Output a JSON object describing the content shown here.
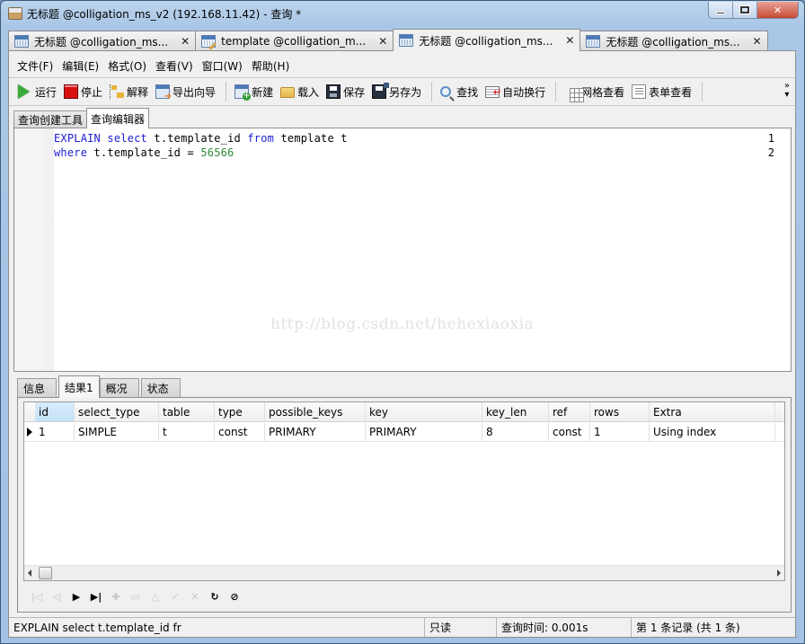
{
  "window": {
    "title": "无标题 @colligation_ms_v2 (192.168.11.42) - 查询 *",
    "controls": {
      "minimize": "minimize",
      "maximize": "maximize",
      "close": "close"
    }
  },
  "doc_tabs": [
    {
      "label": "无标题 @colligation_ms...",
      "icon": "query-grid-icon",
      "active": false
    },
    {
      "label": "template @colligation_m...",
      "icon": "table-edit-icon",
      "active": false
    },
    {
      "label": "无标题 @colligation_ms...",
      "icon": "query-grid-icon",
      "active": true
    },
    {
      "label": "无标题 @colligation_ms...",
      "icon": "query-grid-icon",
      "active": false
    }
  ],
  "doc_tab_close": "✕",
  "menu": [
    "文件(F)",
    "编辑(E)",
    "格式(O)",
    "查看(V)",
    "窗口(W)",
    "帮助(H)"
  ],
  "toolbar": {
    "run": "运行",
    "stop": "停止",
    "explain": "解释",
    "export_wizard": "导出向导",
    "new": "新建",
    "load": "载入",
    "save": "保存",
    "save_as": "另存为",
    "find": "查找",
    "word_wrap": "自动换行",
    "grid_view": "网格查看",
    "form_view": "表单查看",
    "overflow": "»"
  },
  "editor_tabs": [
    {
      "label": "查询创建工具",
      "active": false
    },
    {
      "label": "查询编辑器",
      "active": true
    }
  ],
  "editor": {
    "lines": [
      {
        "no": "1",
        "tokens": [
          {
            "t": "EXPLAIN",
            "k": "kw"
          },
          {
            "t": " "
          },
          {
            "t": "select",
            "k": "kw"
          },
          {
            "t": " t.template_id "
          },
          {
            "t": "from",
            "k": "kw"
          },
          {
            "t": " template t"
          }
        ]
      },
      {
        "no": "2",
        "tokens": [
          {
            "t": "where",
            "k": "kw"
          },
          {
            "t": " t.template_id = "
          },
          {
            "t": "56566",
            "k": "num"
          }
        ]
      }
    ],
    "watermark": "http://blog.csdn.net/hehexiaoxia"
  },
  "result_tabs": [
    {
      "label": "信息",
      "active": false
    },
    {
      "label": "结果1",
      "active": true
    },
    {
      "label": "概况",
      "active": false
    },
    {
      "label": "状态",
      "active": false
    }
  ],
  "result_grid": {
    "columns": [
      "id",
      "select_type",
      "table",
      "type",
      "possible_keys",
      "key",
      "key_len",
      "ref",
      "rows",
      "Extra"
    ],
    "rows": [
      [
        "1",
        "SIMPLE",
        "t",
        "const",
        "PRIMARY",
        "PRIMARY",
        "8",
        "const",
        "1",
        "Using index"
      ]
    ],
    "selected_column": "id",
    "current_row": 0
  },
  "grid_nav": [
    {
      "name": "first-record",
      "glyph": "|◁",
      "enabled": false
    },
    {
      "name": "prev-record",
      "glyph": "◁",
      "enabled": false
    },
    {
      "name": "next-record",
      "glyph": "▶",
      "enabled": true
    },
    {
      "name": "last-record",
      "glyph": "▶|",
      "enabled": true
    },
    {
      "name": "add-record",
      "glyph": "✚",
      "enabled": false
    },
    {
      "name": "delete-record",
      "glyph": "▭",
      "enabled": false
    },
    {
      "name": "edit-record",
      "glyph": "△",
      "enabled": false
    },
    {
      "name": "apply-changes",
      "glyph": "✓",
      "enabled": false
    },
    {
      "name": "discard-changes",
      "glyph": "✕",
      "enabled": false
    },
    {
      "name": "refresh",
      "glyph": "↻",
      "enabled": true
    },
    {
      "name": "stop-query",
      "glyph": "⊘",
      "enabled": true
    }
  ],
  "status": {
    "sql": "EXPLAIN select t.template_id fr",
    "mode": "只读",
    "query_time": "查询时间: 0.001s",
    "record": "第 1 条记录 (共 1 条)"
  }
}
